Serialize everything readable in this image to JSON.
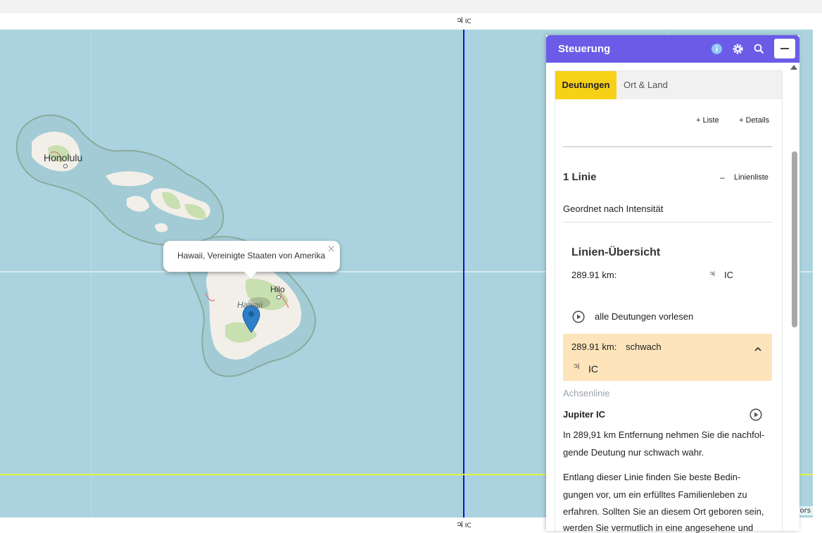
{
  "ruler": {
    "symbol": "♃",
    "label": "IC"
  },
  "map": {
    "places": {
      "honolulu": "Honolulu",
      "hilo": "Hilo",
      "hawaii": "Hawaii"
    },
    "popup_text": "Hawaii, Vereinigte Staaten von Amerika",
    "popup_close": "×",
    "attribution": "ors",
    "colors": {
      "water": "#aad3df",
      "land": "#f2efe9",
      "green": "#c8dfb0",
      "line_blue": "#1010e0",
      "line_yellow": "#e6f03c"
    }
  },
  "panel": {
    "title": "Steuerung",
    "icons": [
      "info-icon",
      "gear-icon",
      "search-icon",
      "minimize-icon"
    ],
    "tabs": [
      "Deutungen",
      "Ort & Land"
    ],
    "liste_label": "+ Liste",
    "details_label": "+ Details",
    "lines_count": "1 Linie",
    "linienliste_dash": "–",
    "linienliste_label": "Linienliste",
    "sort_label": "Geordnet nach Intensität",
    "overview_title": "Linien-Übersicht",
    "overview_distance": "289.91 km:",
    "overview_symbol": "♃",
    "overview_label": "IC",
    "read_all_label": "alle Deutungen vorlesen",
    "entry": {
      "distance": "289.91 km:",
      "strength": "schwach",
      "symbol": "♃",
      "label": "IC",
      "category": "Achsenlinie",
      "name": "Jupiter IC",
      "para1_line1": "In 289,91 km Entfernung nehmen Sie die nachfol-",
      "para1_line2": "gende Deutung nur schwach wahr.",
      "para2_line1": "Entlang dieser Linie finden Sie beste Bedin-",
      "para2_line2": "gungen vor, um ein erfülltes Familienleben zu",
      "para2_line3": "erfahren. Sollten Sie an diesem Ort geboren sein,",
      "para2_line4": "werden Sie vermutlich in eine angesehene und"
    },
    "colors": {
      "header": "#6b5ce7",
      "tab_active": "#f7d117",
      "highlight": "#fde4bb"
    }
  }
}
